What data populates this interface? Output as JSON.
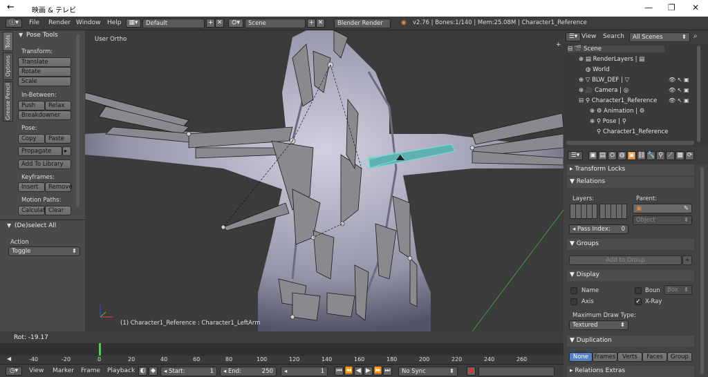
{
  "window": {
    "back_icon": "←",
    "title": "映画 & テレビ",
    "minimize": "—",
    "maximize": "❐",
    "close": "✕"
  },
  "infobar": {
    "menus": [
      "File",
      "Render",
      "Window",
      "Help"
    ],
    "layout": "Default",
    "scene": "Scene",
    "engine": "Blender Render",
    "stats": "v2.76 | Bones:1/140 | Mem:25.08M | Character1_Reference"
  },
  "tools": {
    "tabs": [
      "Tools",
      "Options",
      "Grease Pencil"
    ],
    "panel_title": "Pose Tools",
    "transform_label": "Transform:",
    "translate": "Translate",
    "rotate": "Rotate",
    "scale": "Scale",
    "inbetween_label": "In-Between:",
    "push": "Push",
    "relax": "Relax",
    "breakdowner": "Breakdowner",
    "pose_label": "Pose:",
    "copy": "Copy",
    "paste": "Paste",
    "propagate": "Propagate",
    "add_to_library": "Add To Library",
    "keyframes_label": "Keyframes:",
    "insert": "Insert",
    "remove": "Remove",
    "motion_paths_label": "Motion Paths:",
    "calculate": "Calculat",
    "clear": "Clear",
    "operator_title": "(De)select All",
    "action_label": "Action",
    "action_value": "Toggle"
  },
  "viewport": {
    "view_name": "User Ortho",
    "object_info": "(1) Character1_Reference : Character1_LeftArm"
  },
  "status": {
    "rot": "Rot: -19.17"
  },
  "timeline": {
    "ticks": [
      "-40",
      "-20",
      "0",
      "20",
      "40",
      "60",
      "80",
      "100",
      "120",
      "140",
      "160",
      "180",
      "200",
      "220",
      "240",
      "260"
    ],
    "current_frame": 0
  },
  "tlheader": {
    "menus": [
      "View",
      "Marker",
      "Frame",
      "Playback"
    ],
    "start_label": "Start:",
    "start": "1",
    "end_label": "End:",
    "end": "250",
    "frame": "1",
    "sync": "No Sync"
  },
  "outliner": {
    "view": "View",
    "search": "Search",
    "filter": "All Scenes",
    "items": [
      {
        "label": "Scene",
        "indent": 0
      },
      {
        "label": "RenderLayers",
        "indent": 1
      },
      {
        "label": "World",
        "indent": 1
      },
      {
        "label": "BLW_DEF",
        "indent": 1
      },
      {
        "label": "Camera",
        "indent": 1
      },
      {
        "label": "Character1_Reference",
        "indent": 1
      },
      {
        "label": "Animation",
        "indent": 2
      },
      {
        "label": "Pose",
        "indent": 2
      },
      {
        "label": "Character1_Reference",
        "indent": 2
      }
    ]
  },
  "props": {
    "transform_locks": "Transform Locks",
    "relations": "Relations",
    "layers": "Layers:",
    "parent": "Parent:",
    "parent_type": "Object",
    "pass_index_label": "Pass Index:",
    "pass_index": "0",
    "groups": "Groups",
    "add_to_group": "Add to Group",
    "display": "Display",
    "name": "Name",
    "bounds": "Boun",
    "bounds_type": "Box",
    "axis": "Axis",
    "xray": "X-Ray",
    "max_draw_type_label": "Maximum Draw Type:",
    "max_draw_type": "Textured",
    "duplication": "Duplication",
    "dup_options": [
      "None",
      "Frames",
      "Verts",
      "Faces",
      "Group"
    ],
    "relations_extras": "Relations Extras"
  },
  "colors": {
    "accent": "#5680c2",
    "bone_select": "#7fd8d8",
    "frame_marker": "#50d050"
  }
}
